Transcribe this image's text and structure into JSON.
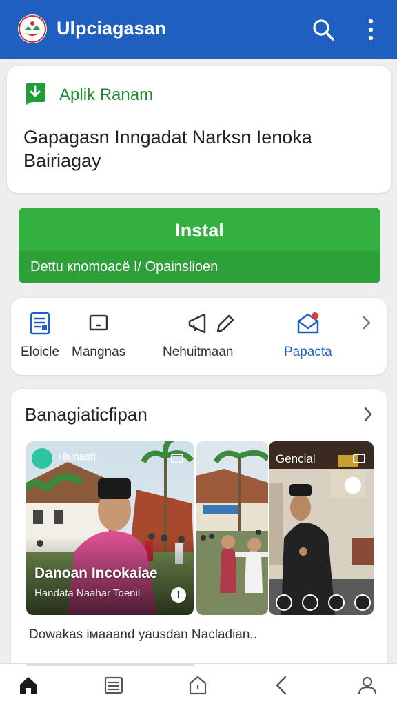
{
  "app": {
    "title": "Ulpciagasan"
  },
  "promo": {
    "label": "Aplik Ranam",
    "text": "Gapagasn Inngadat Narksn Ienoka Bairiagay"
  },
  "install": {
    "label": "Instal",
    "sub": "Dettu кnоmоасё I/ Opainslioen"
  },
  "quick_actions": [
    {
      "label": "Eloicle",
      "icon": "document-icon"
    },
    {
      "label": "Mangnas",
      "icon": "tablet-icon"
    },
    {
      "label": "Nehuitmaan",
      "icon": "megaphone-icon"
    },
    {
      "label": "",
      "icon": "pen-icon"
    },
    {
      "label": "Papacta",
      "icon": "mail-icon"
    }
  ],
  "section": {
    "title": "Banagiatіcfipan",
    "tile1": {
      "tag": "Hainasri",
      "title": "Danoan Incokaiae",
      "sub": "Handata Naahar Toenil",
      "alert": "!"
    },
    "tile3": {
      "tag": "Gencial"
    },
    "caption": "Dowakas iмaaand yausdan Nacladian.."
  },
  "colors": {
    "appbar": "#1f5fbf",
    "install": "#33b040",
    "accent_green": "#1e8a2e"
  }
}
